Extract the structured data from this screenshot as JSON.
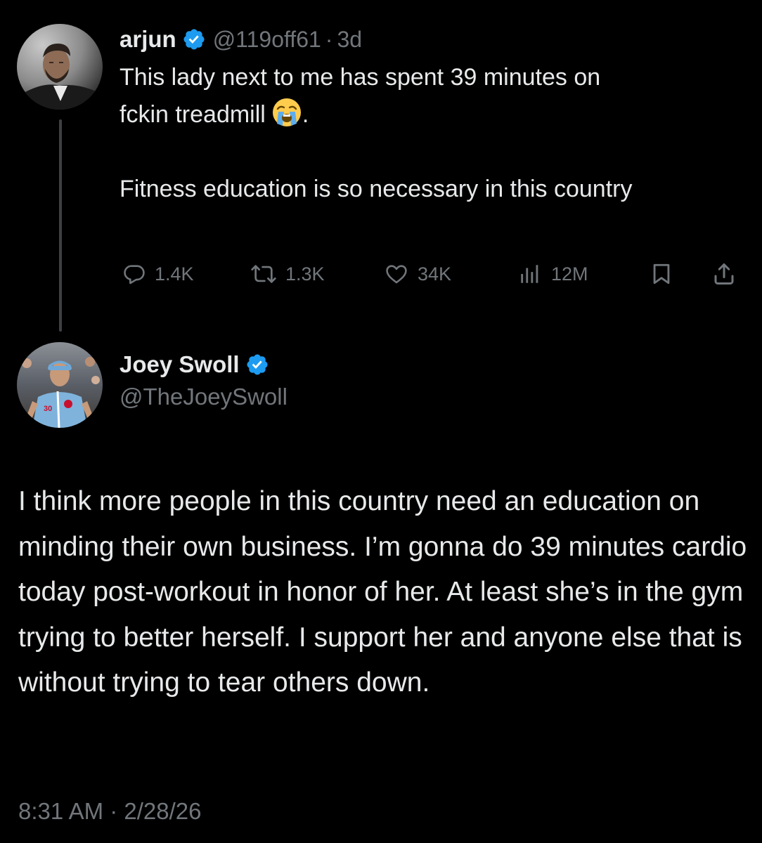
{
  "original_tweet": {
    "author_name": "arjun",
    "handle": "@119off61",
    "separator": "·",
    "age": "3d",
    "text_line1": "This lady next to me has spent 39 minutes on",
    "text_line2": "fckin treadmill",
    "emoji_icon": "loudly-crying-face-emoji",
    "text_line2_end": ".",
    "text_para2": "Fitness education is so necessary in this country",
    "stats": {
      "replies": "1.4K",
      "reposts": "1.3K",
      "likes": "34K",
      "views": "12M"
    },
    "icons": [
      "reply-icon",
      "repost-icon",
      "like-icon",
      "views-icon",
      "bookmark-icon",
      "share-icon"
    ]
  },
  "reply_tweet": {
    "author_name": "Joey Swoll",
    "handle": "@TheJoeySwoll",
    "text": "I think more people in this country need an education on minding their own business. I’m gonna do 39 minutes cardio today post-workout in honor of her. At least she’s in the gym trying to better herself. I support her and anyone else that is without trying to tear others down.",
    "timestamp": "8:31 AM · 2/28/26"
  },
  "colors": {
    "background": "#000000",
    "primary_text": "#e7e9ea",
    "secondary_text": "#71767b",
    "verified_badge": "#1d9bf0",
    "thread_line": "#3e4144"
  }
}
